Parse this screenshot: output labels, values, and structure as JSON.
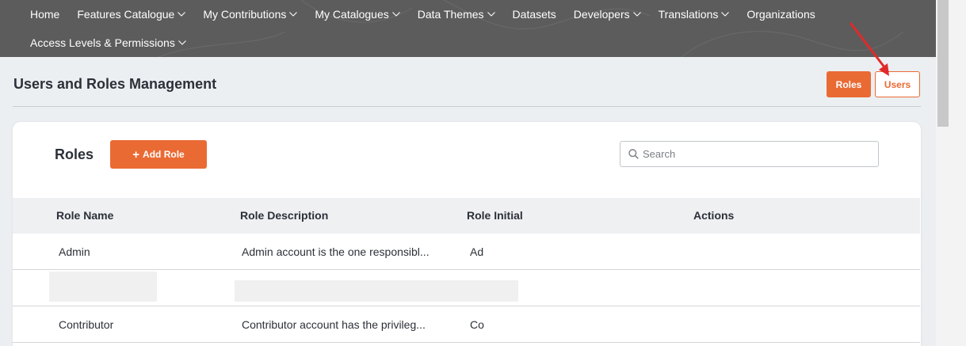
{
  "nav": {
    "row1": [
      {
        "label": "Home",
        "dropdown": false
      },
      {
        "label": "Features Catalogue",
        "dropdown": true
      },
      {
        "label": "My Contributions",
        "dropdown": true
      },
      {
        "label": "My Catalogues",
        "dropdown": true
      },
      {
        "label": "Data Themes",
        "dropdown": true
      },
      {
        "label": "Datasets",
        "dropdown": false
      },
      {
        "label": "Developers",
        "dropdown": true
      },
      {
        "label": "Translations",
        "dropdown": true
      },
      {
        "label": "Organizations",
        "dropdown": false
      }
    ],
    "row2": [
      {
        "label": "Access Levels & Permissions",
        "dropdown": true
      }
    ]
  },
  "page": {
    "title": "Users and Roles Management",
    "toggle": {
      "roles_label": "Roles",
      "users_label": "Users"
    }
  },
  "roles_card": {
    "title": "Roles",
    "add_button": "Add Role",
    "search": {
      "placeholder": "Search",
      "value": ""
    },
    "columns": [
      "Role Name",
      "Role Description",
      "Role Initial",
      "Actions"
    ],
    "rows": [
      {
        "name": "Admin",
        "description": "Admin account is the one responsibl...",
        "initial": "Ad"
      },
      {
        "name": "",
        "description": "",
        "initial": ""
      },
      {
        "name": "Contributor",
        "description": "Contributor account has the privileg...",
        "initial": "Co"
      }
    ]
  },
  "colors": {
    "accent": "#ea6a34",
    "nav_bg": "#5c5c5c",
    "page_bg": "#eceff2",
    "annotation_arrow": "#e02a2a"
  },
  "icons": {
    "search": "search-icon",
    "dropdown": "chevron-down-icon",
    "add": "plus-icon"
  }
}
